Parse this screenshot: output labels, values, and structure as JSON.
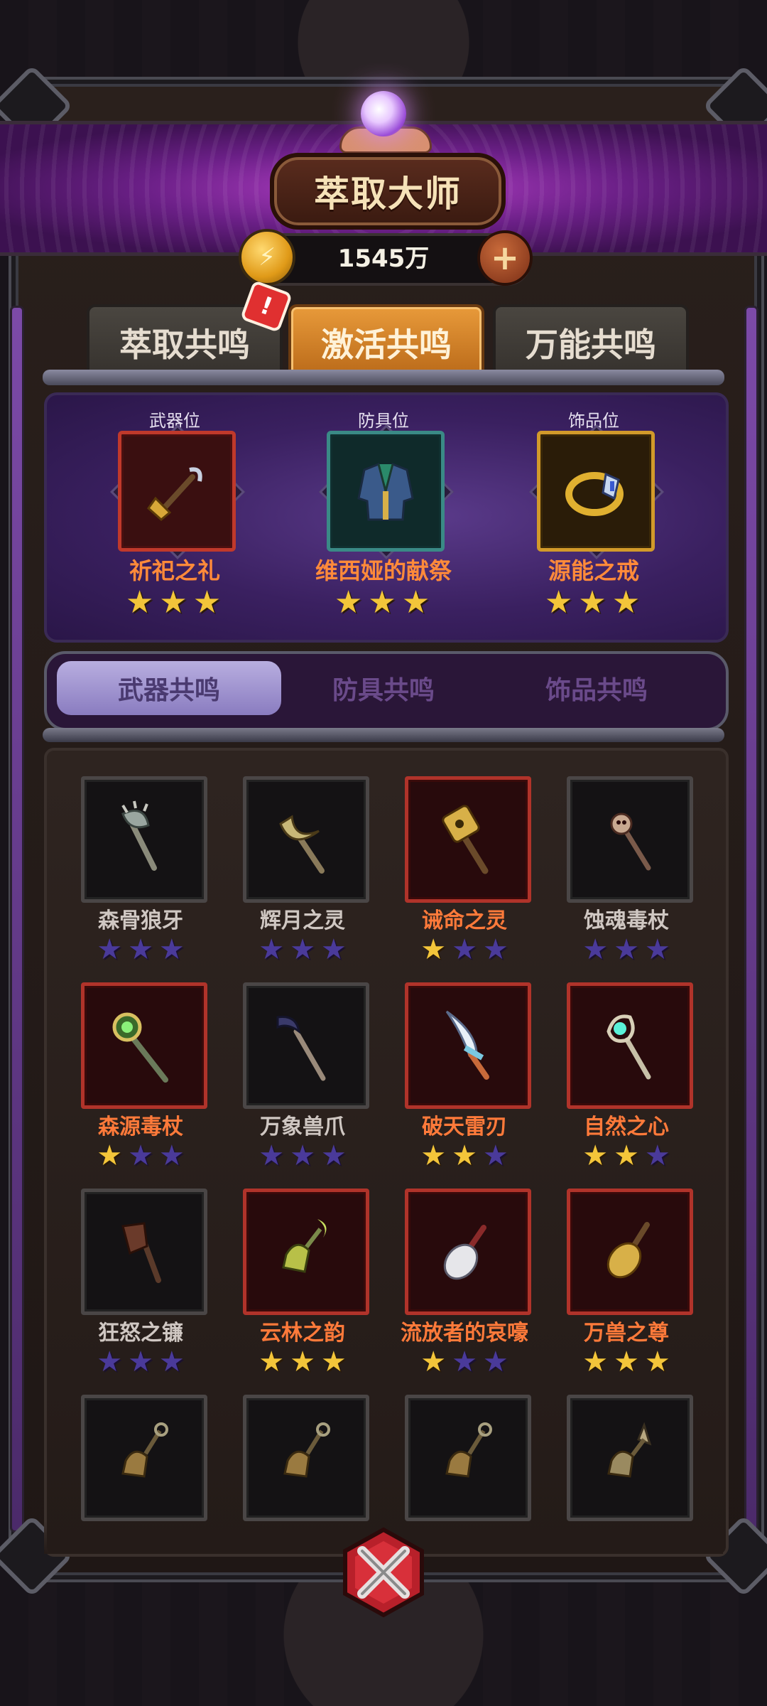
{
  "header": {
    "title": "萃取大师",
    "currency_amount": "1545万",
    "coin_icon": "coin-icon",
    "add_icon": "plus-icon"
  },
  "tabs": [
    {
      "label": "萃取共鸣",
      "active": false,
      "alert": "!"
    },
    {
      "label": "激活共鸣",
      "active": true
    },
    {
      "label": "万能共鸣",
      "active": false
    }
  ],
  "slots": [
    {
      "label": "武器位",
      "name": "祈祀之礼",
      "stars": 3,
      "frame": "red",
      "icon": "bell-staff-icon"
    },
    {
      "label": "防具位",
      "name": "维西娅的献祭",
      "stars": 3,
      "frame": "teal",
      "icon": "armor-jacket-icon"
    },
    {
      "label": "饰品位",
      "name": "源能之戒",
      "stars": 3,
      "frame": "gold",
      "icon": "ring-icon"
    }
  ],
  "subtabs": [
    {
      "label": "武器共鸣",
      "active": true
    },
    {
      "label": "防具共鸣",
      "active": false
    },
    {
      "label": "饰品共鸣",
      "active": false
    }
  ],
  "items": [
    {
      "name": "森骨狼牙",
      "rarity": "grey",
      "stars": 0,
      "icon": "bone-axe-icon"
    },
    {
      "name": "辉月之灵",
      "rarity": "grey",
      "stars": 0,
      "icon": "crescent-staff-icon"
    },
    {
      "name": "诫命之灵",
      "rarity": "red",
      "stars": 1,
      "icon": "golden-scepter-icon"
    },
    {
      "name": "蚀魂毒杖",
      "rarity": "grey",
      "stars": 0,
      "icon": "skull-staff-icon"
    },
    {
      "name": "森源毒杖",
      "rarity": "red",
      "stars": 1,
      "icon": "orb-staff-icon"
    },
    {
      "name": "万象兽爪",
      "rarity": "grey",
      "stars": 0,
      "icon": "claw-staff-icon"
    },
    {
      "name": "破天雷刃",
      "rarity": "red",
      "stars": 2,
      "icon": "blade-icon"
    },
    {
      "name": "自然之心",
      "rarity": "red",
      "stars": 2,
      "icon": "crystal-staff-icon"
    },
    {
      "name": "狂怒之镰",
      "rarity": "grey",
      "stars": 0,
      "icon": "scythe-icon"
    },
    {
      "name": "云林之韵",
      "rarity": "red",
      "stars": 3,
      "icon": "moon-bell-icon"
    },
    {
      "name": "流放者的哀嚎",
      "rarity": "red",
      "stars": 1,
      "icon": "white-rattle-icon"
    },
    {
      "name": "万兽之尊",
      "rarity": "red",
      "stars": 3,
      "icon": "gold-rattle-icon"
    },
    {
      "name": "",
      "rarity": "grey",
      "stars": 0,
      "icon": "bell-icon"
    },
    {
      "name": "",
      "rarity": "grey",
      "stars": 0,
      "icon": "bell-icon"
    },
    {
      "name": "",
      "rarity": "grey",
      "stars": 0,
      "icon": "bell-icon"
    },
    {
      "name": "",
      "rarity": "grey",
      "stars": 0,
      "icon": "spear-bell-icon"
    }
  ],
  "colors": {
    "banner_purple": "#6a1f86",
    "active_tab": "#e89a3a",
    "star_on": "#f3c53a",
    "star_off": "#4a3a9a",
    "red_frame": "#b0332a",
    "grey_frame": "#4a4646"
  }
}
